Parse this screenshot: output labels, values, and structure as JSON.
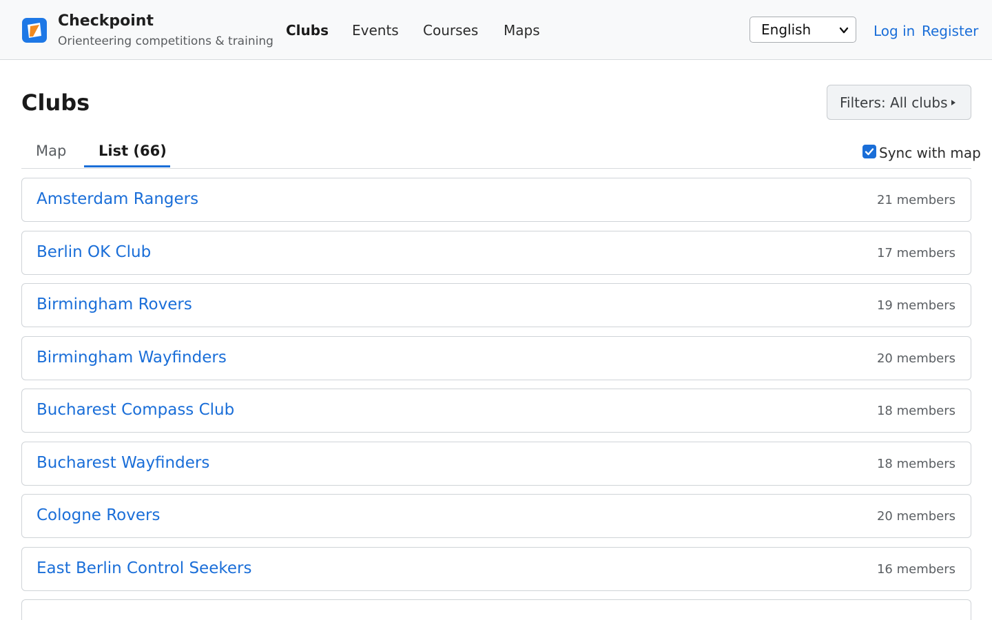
{
  "brand": {
    "name": "Checkpoint",
    "tagline": "Orienteering competitions & training"
  },
  "nav": {
    "items": [
      {
        "label": "Clubs",
        "active": true
      },
      {
        "label": "Events",
        "active": false
      },
      {
        "label": "Courses",
        "active": false
      },
      {
        "label": "Maps",
        "active": false
      }
    ]
  },
  "language": {
    "selected": "English"
  },
  "auth": {
    "login": "Log in",
    "register": "Register"
  },
  "page": {
    "title": "Clubs",
    "filters_label": "Filters: All clubs"
  },
  "tabs": {
    "map": "Map",
    "list": "List (66)"
  },
  "sync": {
    "label": "Sync with map",
    "checked": true
  },
  "clubs": [
    {
      "name": "Amsterdam Rangers",
      "members": "21 members"
    },
    {
      "name": "Berlin OK Club",
      "members": "17 members"
    },
    {
      "name": "Birmingham Rovers",
      "members": "19 members"
    },
    {
      "name": "Birmingham Wayfinders",
      "members": "20 members"
    },
    {
      "name": "Bucharest Compass Club",
      "members": "18 members"
    },
    {
      "name": "Bucharest Wayfinders",
      "members": "18 members"
    },
    {
      "name": "Cologne Rovers",
      "members": "20 members"
    },
    {
      "name": "East Berlin Control Seekers",
      "members": "16 members"
    }
  ],
  "colors": {
    "accent": "#1a6ed8",
    "logo_blue": "#1e78e6",
    "logo_orange": "#f28a1e",
    "header_bg": "#f8f9fa"
  },
  "icons": {
    "logo": "checkpoint-logo-icon",
    "language_dropdown": "chevron-down-icon",
    "filters": "caret-right-icon",
    "sync_checkbox": "checkmark-icon"
  }
}
